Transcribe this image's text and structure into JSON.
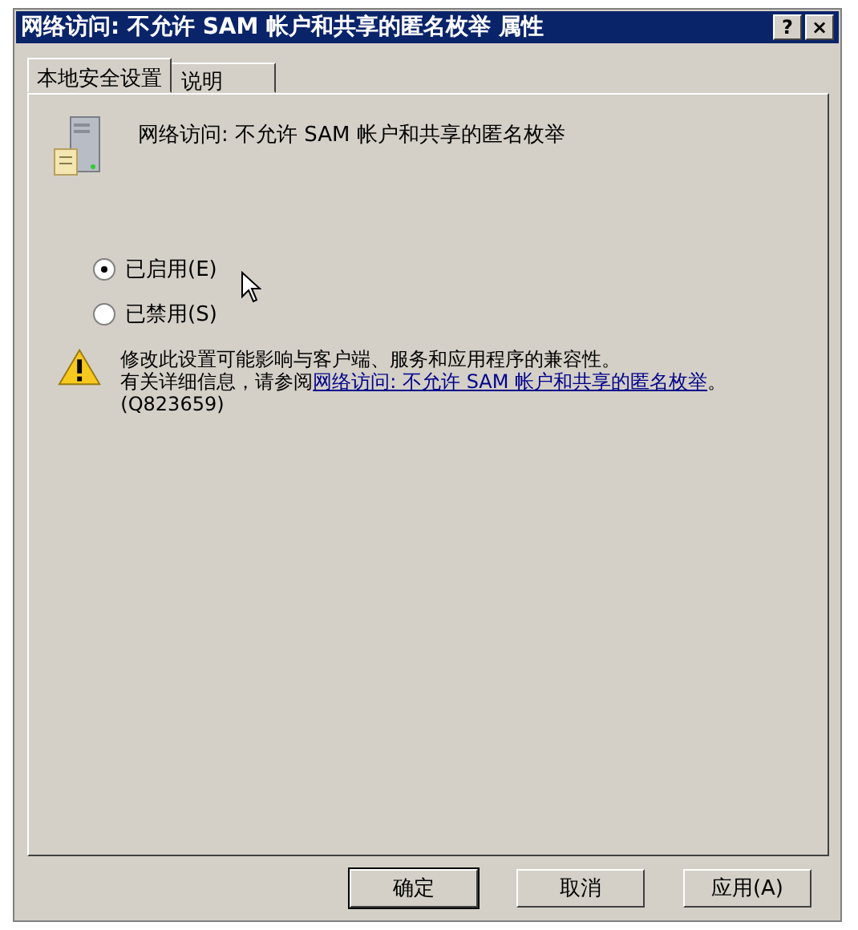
{
  "window": {
    "title": "网络访问: 不允许 SAM 帐户和共享的匿名枚举 属性",
    "controls": [
      "?",
      "×"
    ]
  },
  "tabs": [
    {
      "label": "本地安全设置",
      "selected": true
    },
    {
      "label": "说明",
      "selected": false
    }
  ],
  "policy": {
    "name": "网络访问: 不允许 SAM 帐户和共享的匿名枚举"
  },
  "options": [
    {
      "label": "已启用(E)",
      "selected": true
    },
    {
      "label": "已禁用(S)",
      "selected": false
    }
  ],
  "warning": {
    "text": "修改此设置可能影响与客户端、服务和应用程序的兼容性。",
    "more": "有关详细信息，请参阅",
    "link": "网络访问: 不允许 SAM 帐户和共享的匿名枚举",
    "after": "。 (Q823659)"
  },
  "buttons": [
    {
      "label": "确定",
      "default": true
    },
    {
      "label": "取消",
      "default": false
    },
    {
      "label": "应用(A)",
      "default": false
    }
  ]
}
